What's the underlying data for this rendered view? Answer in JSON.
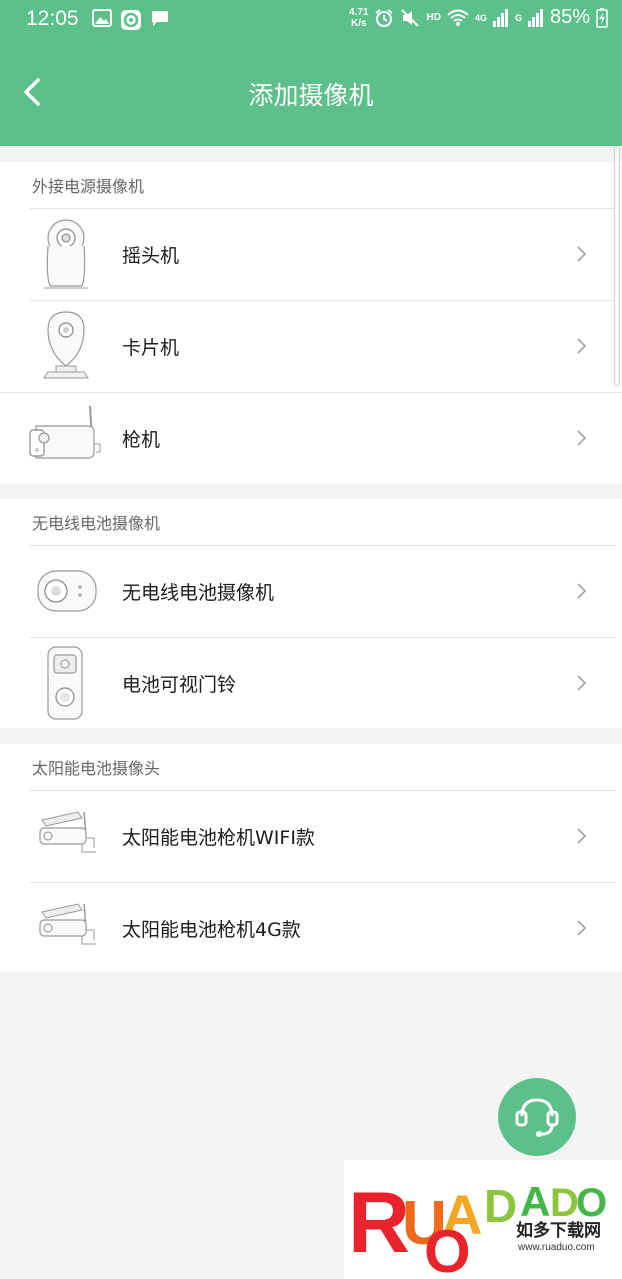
{
  "status_bar": {
    "time": "12:05",
    "speed_value": "4.71",
    "speed_unit": "K/s",
    "hd": "HD",
    "signal1": "4G",
    "signal2": "G",
    "battery": "85%"
  },
  "header": {
    "title": "添加摄像机",
    "back_icon": "chevron-left-icon"
  },
  "sections": [
    {
      "title": "外接电源摄像机",
      "items": [
        {
          "label": "摇头机",
          "icon": "pan-tilt-camera-icon"
        },
        {
          "label": "卡片机",
          "icon": "card-camera-icon"
        },
        {
          "label": "枪机",
          "icon": "bullet-camera-icon"
        }
      ]
    },
    {
      "title": "无电线电池摄像机",
      "items": [
        {
          "label": "无电线电池摄像机",
          "icon": "battery-camera-icon"
        },
        {
          "label": "电池可视门铃",
          "icon": "video-doorbell-icon"
        }
      ]
    },
    {
      "title": "太阳能电池摄像头",
      "items": [
        {
          "label": "太阳能电池枪机WIFI款",
          "icon": "solar-bullet-camera-icon"
        },
        {
          "label": "太阳能电池枪机4G款",
          "icon": "solar-bullet-camera-icon"
        }
      ]
    }
  ],
  "support": {
    "icon": "headset-icon"
  },
  "watermark": {
    "logo_text": "RUANDUO",
    "cn_text": "如多下载网",
    "url": "www.ruaduo.com"
  },
  "colors": {
    "primary": "#5cc08a",
    "background": "#f4f4f4"
  }
}
